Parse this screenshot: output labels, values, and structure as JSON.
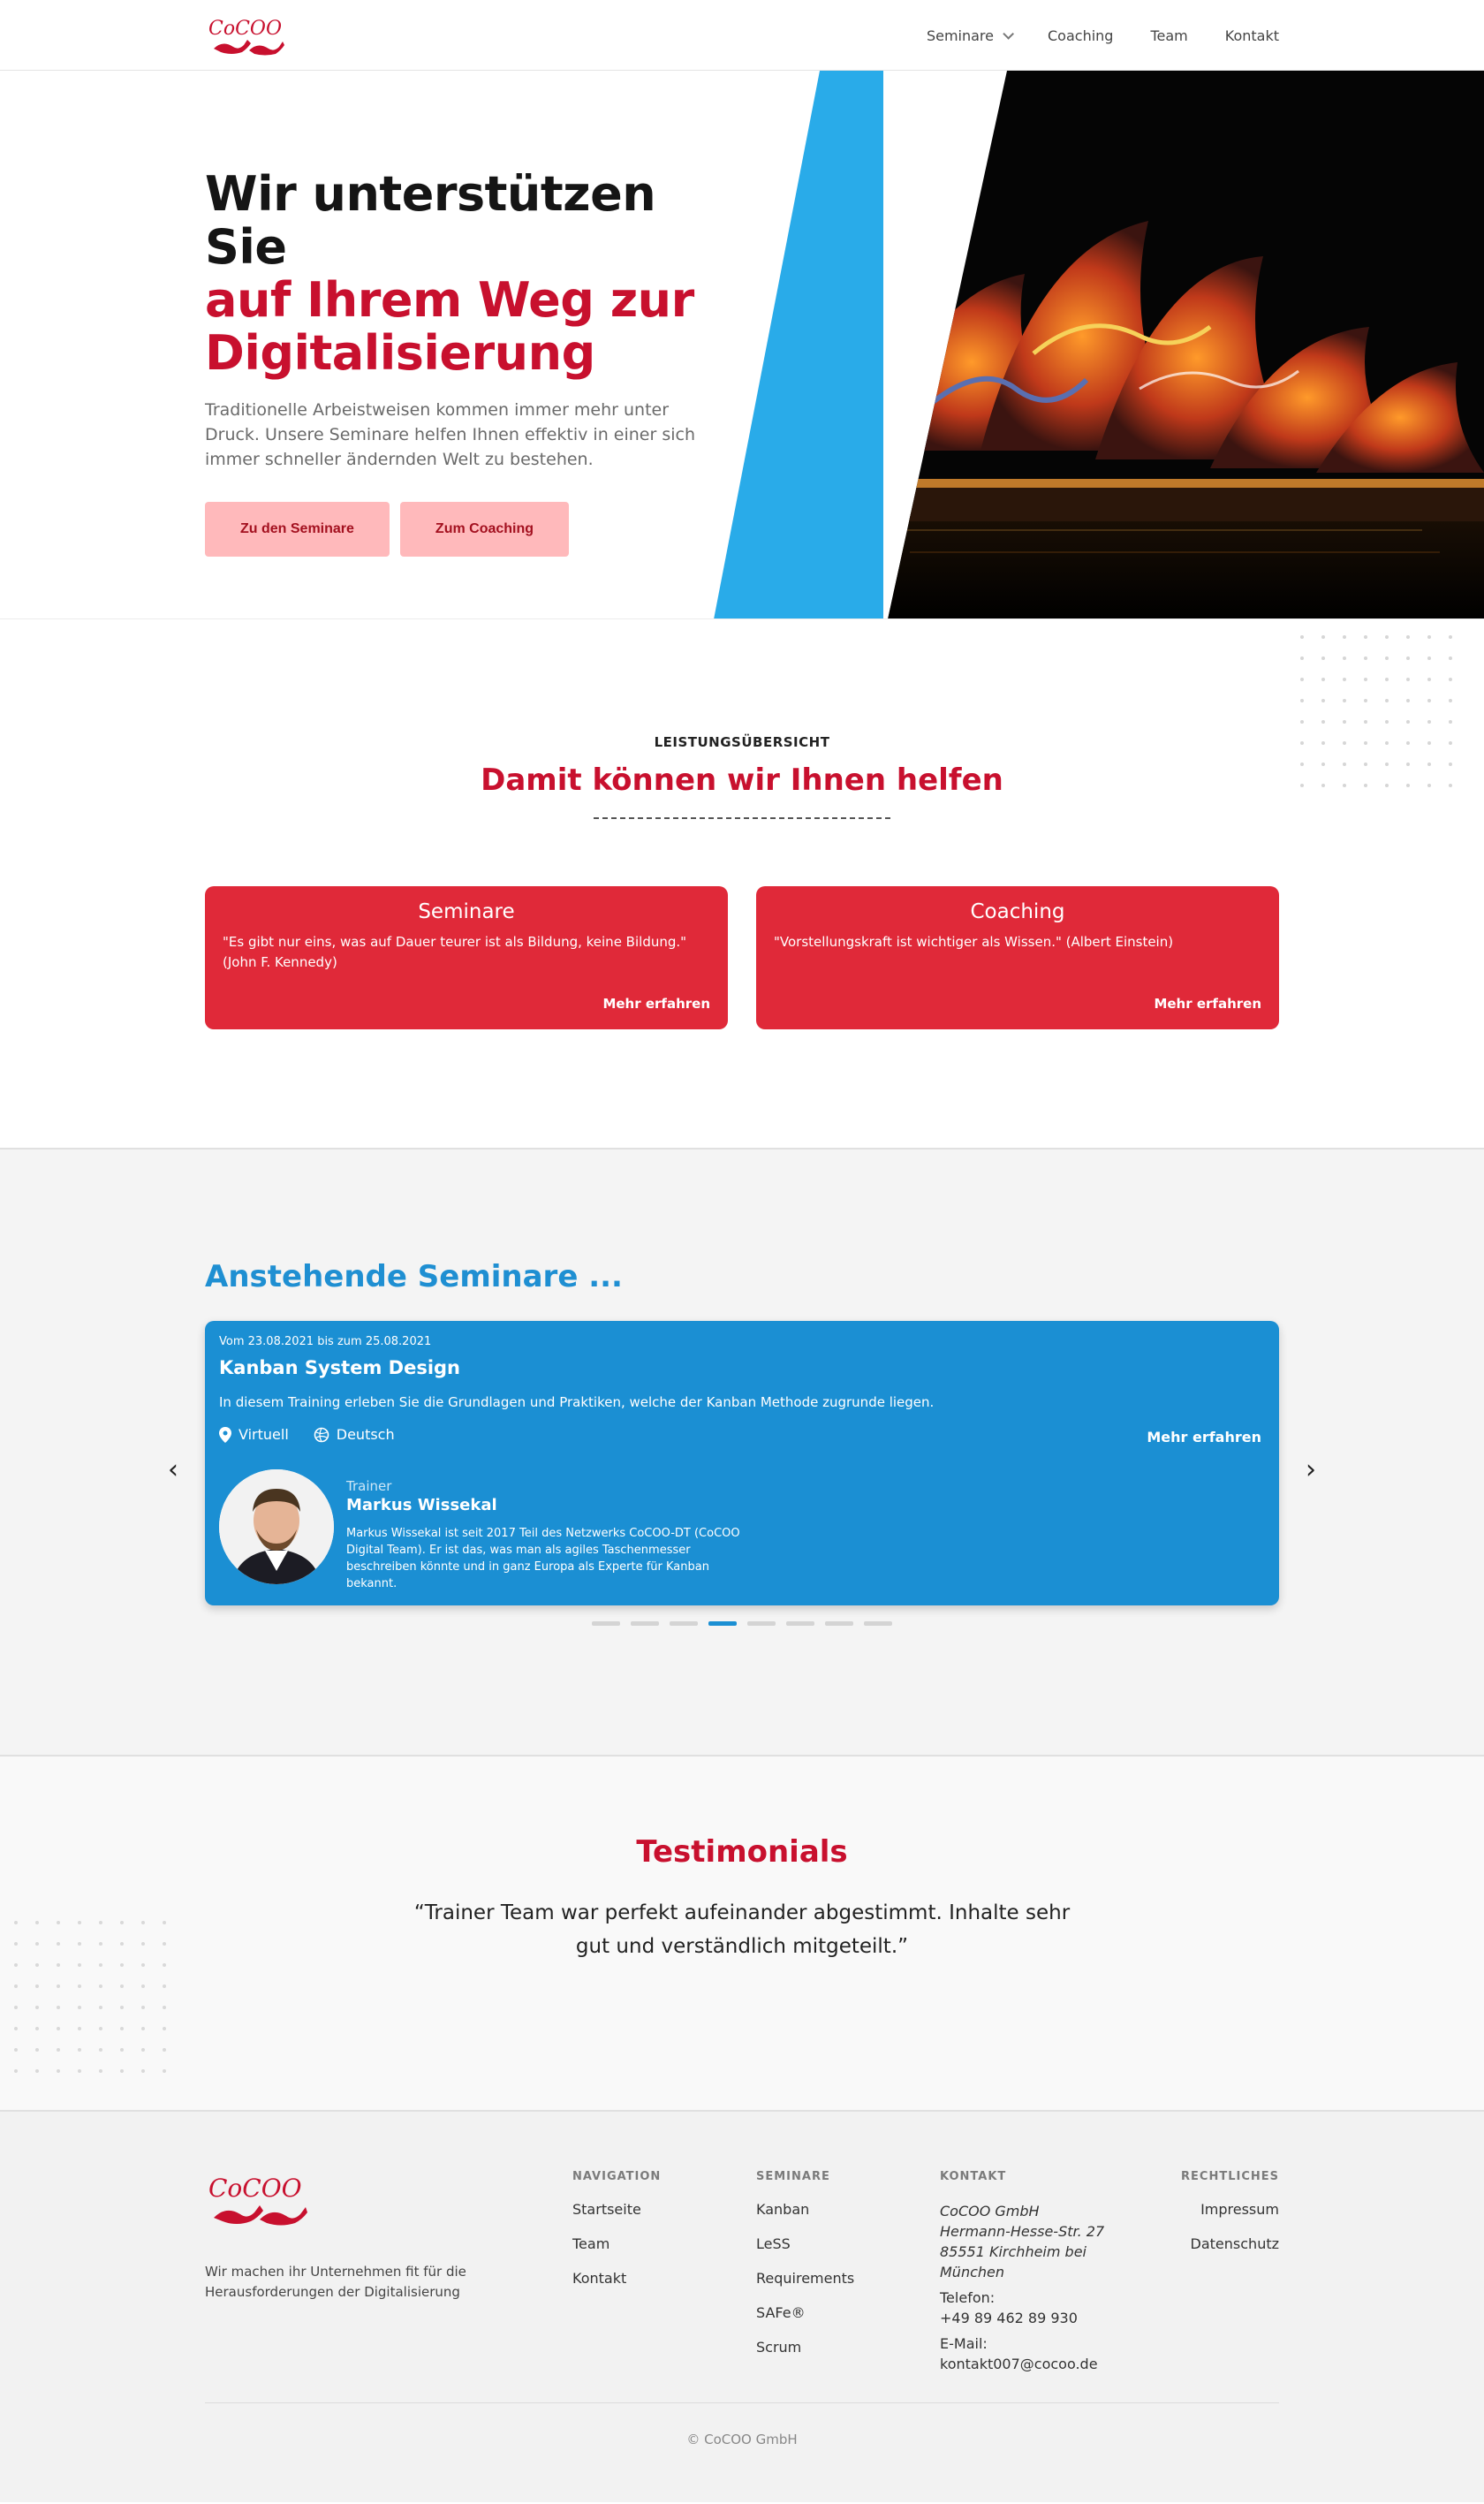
{
  "nav": {
    "logo_text": "CoCOO",
    "items": [
      {
        "label": "Seminare",
        "has_dropdown": true
      },
      {
        "label": "Coaching"
      },
      {
        "label": "Team"
      },
      {
        "label": "Kontakt"
      }
    ]
  },
  "hero": {
    "title_line1": "Wir unterstützen Sie",
    "title_line2": "auf Ihrem Weg zur Digitalisierung",
    "subtitle": "Traditionelle Arbeistweisen kommen immer mehr unter Druck. Unsere Seminare helfen Ihnen effektiv in einer sich immer schneller ändernden Welt zu bestehen.",
    "btn_seminare": "Zu den Seminare",
    "btn_coaching": "Zum Coaching"
  },
  "leistung": {
    "kicker": "LEISTUNGSÜBERSICHT",
    "title": "Damit können wir Ihnen helfen",
    "cards": [
      {
        "title": "Seminare",
        "quote": "\"Es gibt nur eins, was auf Dauer teurer ist als Bildung, keine Bildung.\" (John F. Kennedy)",
        "more": "Mehr erfahren"
      },
      {
        "title": "Coaching",
        "quote": "\"Vorstellungskraft ist wichtiger als Wissen.\" (Albert Einstein)",
        "more": "Mehr erfahren"
      }
    ]
  },
  "seminare": {
    "title": "Anstehende Seminare ...",
    "card": {
      "date": "Vom 23.08.2021 bis zum 25.08.2021",
      "name": "Kanban System Design",
      "description": "In diesem Training erleben Sie die Grundlagen und Praktiken, welche der Kanban Methode zugrunde liegen.",
      "location": "Virtuell",
      "language": "Deutsch",
      "more": "Mehr erfahren",
      "trainer_role": "Trainer",
      "trainer_name": "Markus Wissekal",
      "trainer_bio": "Markus Wissekal ist seit 2017 Teil des Netzwerks CoCOO-DT (CoCOO Digital Team). Er ist das, was man als agiles Taschenmesser beschreiben könnte und in ganz Europa als Experte für Kanban bekannt."
    },
    "arrow_left": "‹",
    "arrow_right": "›",
    "pager_count": 8,
    "pager_active_index": 3
  },
  "testimonials": {
    "title": "Testimonials",
    "quote": "“Trainer Team war perfekt aufeinander abgestimmt. Inhalte sehr gut und verständlich mitgeteilt.”"
  },
  "footer": {
    "tagline": "Wir machen ihr Unternehmen fit für die Herausforderungen der Digitalisierung",
    "navigation": {
      "heading": "NAVIGATION",
      "items": [
        "Startseite",
        "Team",
        "Kontakt"
      ]
    },
    "seminare": {
      "heading": "SEMINARE",
      "items": [
        "Kanban",
        "LeSS",
        "Requirements",
        "SAFe®",
        "Scrum"
      ]
    },
    "kontakt": {
      "heading": "KONTAKT",
      "company": "CoCOO GmbH",
      "street": "Hermann-Hesse-Str. 27",
      "city": "85551 Kirchheim bei München",
      "phone_label": "Telefon:",
      "phone": "+49 89 462 89 930",
      "email_label": "E-Mail:",
      "email": "kontakt007@cocoo.de"
    },
    "rechtliches": {
      "heading": "RECHTLICHES",
      "items": [
        "Impressum",
        "Datenschutz"
      ]
    },
    "copyright": "© CoCOO GmbH"
  },
  "colors": {
    "brand_red": "#c8102e",
    "card_red": "#e02939",
    "accent_blue": "#1b8fd3",
    "hero_blue": "#29abe9",
    "button_pink": "#ffb9bb"
  }
}
